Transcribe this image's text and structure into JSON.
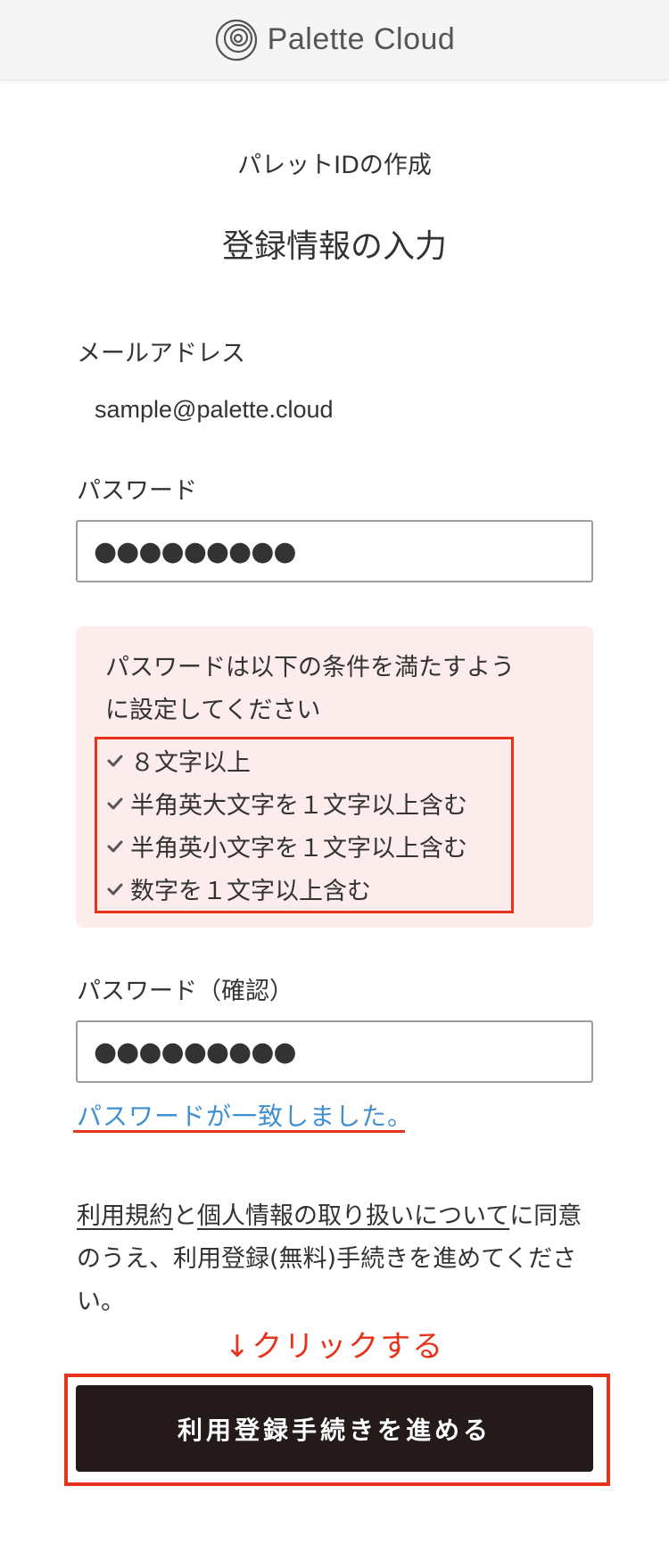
{
  "header": {
    "logo_text": "Palette Cloud",
    "logo_icon": "spiral-logo-icon"
  },
  "page": {
    "subtitle": "パレットIDの作成",
    "title": "登録情報の入力"
  },
  "email": {
    "label": "メールアドレス",
    "value": "sample@palette.cloud"
  },
  "password": {
    "label": "パスワード",
    "value": "●●●●●●●●●"
  },
  "conditions": {
    "intro_line1": "パスワードは以下の条件を満たすよう",
    "intro_line2": "に設定してください",
    "check_icon": "checkmark-icon",
    "items": [
      "８文字以上",
      "半角英大文字を１文字以上含む",
      "半角英小文字を１文字以上含む",
      "数字を１文字以上含む"
    ]
  },
  "password_confirm": {
    "label": "パスワード（確認）",
    "value": "●●●●●●●●●",
    "match_message": "パスワードが一致しました。"
  },
  "agreement": {
    "terms_link": "利用規約",
    "and": "と",
    "privacy_link": "個人情報の取り扱いについて",
    "tail": "に同意のうえ、利用登録(無料)手続きを進めてください。"
  },
  "annotation": {
    "click_hint": "↓クリックする"
  },
  "submit": {
    "label": "利用登録手続きを進める"
  },
  "colors": {
    "accent_red": "#e8331c",
    "link_blue": "#3f8fd2",
    "button_bg": "#241a1a",
    "condition_bg": "#fdecec"
  }
}
